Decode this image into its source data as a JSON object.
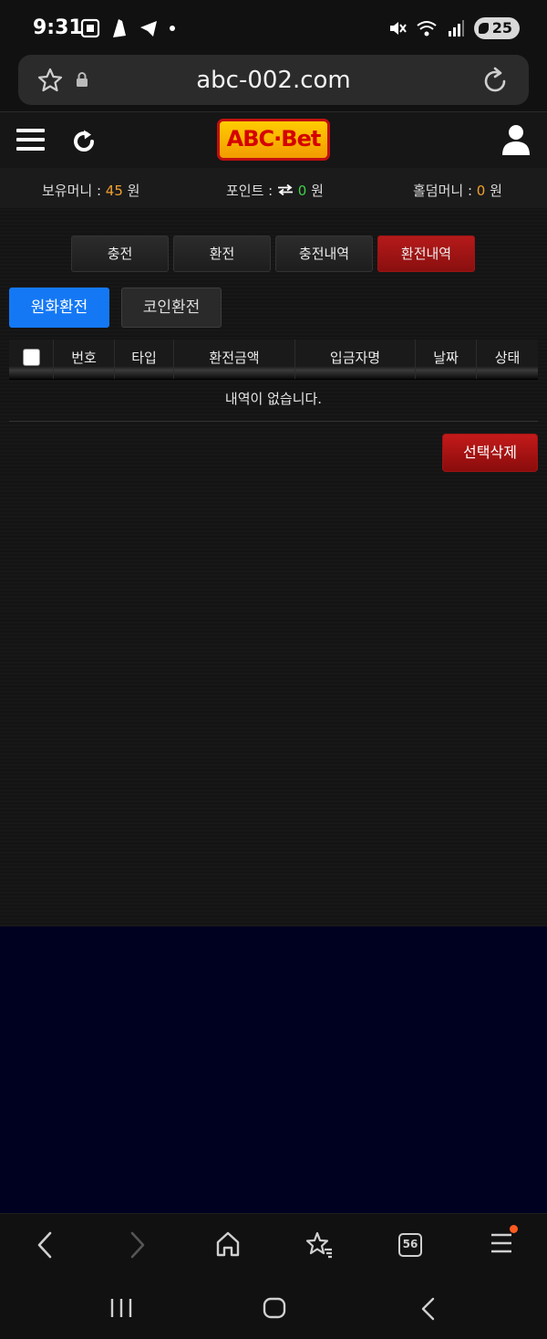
{
  "status_bar": {
    "time": "9:31",
    "battery_level": "25",
    "left_icons": [
      "screenshot-icon",
      "notification-icon",
      "telegram-icon",
      "dot-icon"
    ],
    "right_icons": [
      "mute-icon",
      "wifi-icon",
      "signal-icon",
      "battery-icon"
    ]
  },
  "browser": {
    "url": "abc-002.com",
    "tab_count": "56"
  },
  "header": {
    "logo_text": "ABC·Bet"
  },
  "balances": {
    "money_label": "보유머니 : ",
    "money_value": "45",
    "money_unit": " 원",
    "point_label": "포인트 : ",
    "point_value": "0",
    "point_unit": " 원",
    "holdem_label": "홀덤머니 : ",
    "holdem_value": "0",
    "holdem_unit": " 원"
  },
  "main_tabs": [
    {
      "label": "충전",
      "active": false
    },
    {
      "label": "환전",
      "active": false
    },
    {
      "label": "충전내역",
      "active": false
    },
    {
      "label": "환전내역",
      "active": true
    }
  ],
  "sub_tabs": [
    {
      "label": "원화환전",
      "active": true
    },
    {
      "label": "코인환전",
      "active": false
    }
  ],
  "table": {
    "columns": [
      "번호",
      "타입",
      "환전금액",
      "입금자명",
      "날짜",
      "상태"
    ],
    "empty_message": "내역이 없습니다."
  },
  "actions": {
    "delete_selected": "선택삭제"
  },
  "colors": {
    "accent_orange": "#f0a030",
    "accent_green": "#3fd14a",
    "active_tab_red": "#b51a1a",
    "primary_blue": "#1478f5"
  }
}
